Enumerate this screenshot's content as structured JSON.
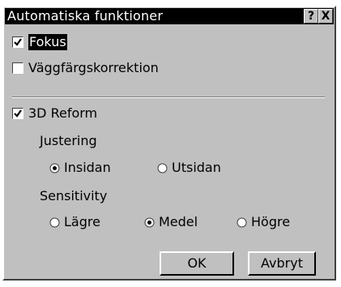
{
  "window": {
    "title": "Automatiska funktioner",
    "help_label": "?",
    "close_label": "X"
  },
  "options": {
    "fokus": {
      "label": "Fokus",
      "checked": true
    },
    "wall": {
      "label": "Väggfärgskorrektion",
      "checked": false
    },
    "reform3d": {
      "label": "3D Reform",
      "checked": true
    }
  },
  "justering": {
    "label": "Justering",
    "options": [
      {
        "label": "Insidan",
        "selected": true
      },
      {
        "label": "Utsidan",
        "selected": false
      }
    ]
  },
  "sensitivity": {
    "label": "Sensitivity",
    "options": [
      {
        "label": "Lägre",
        "selected": false
      },
      {
        "label": "Medel",
        "selected": true
      },
      {
        "label": "Högre",
        "selected": false
      }
    ]
  },
  "buttons": {
    "ok": "OK",
    "cancel": "Avbryt"
  }
}
